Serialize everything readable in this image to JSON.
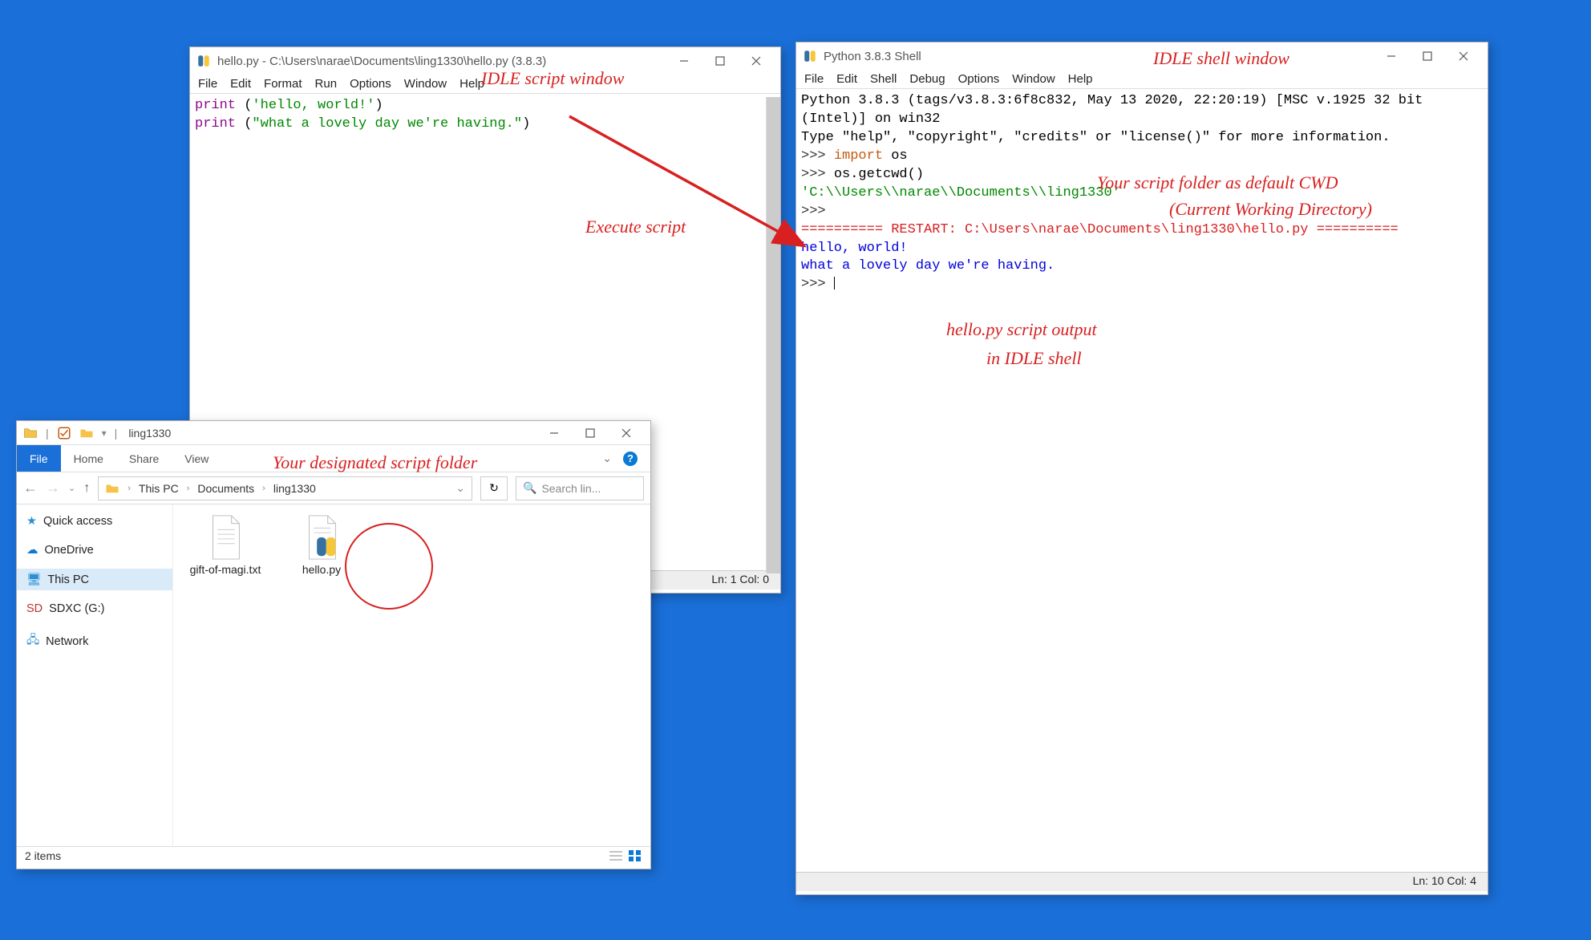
{
  "script_window": {
    "title": "hello.py - C:\\Users\\narae\\Documents\\ling1330\\hello.py (3.8.3)",
    "menu": [
      "File",
      "Edit",
      "Format",
      "Run",
      "Options",
      "Window",
      "Help"
    ],
    "line1_call": "print ",
    "line1_paren_open": "(",
    "line1_str": "'hello, world!'",
    "line1_paren_close": ")",
    "line2_call": "print ",
    "line2_paren_open": "(",
    "line2_str": "\"what a lovely day we're having.\"",
    "line2_paren_close": ")",
    "status": "Ln: 1  Col: 0"
  },
  "shell_window": {
    "title": "Python 3.8.3 Shell",
    "menu": [
      "File",
      "Edit",
      "Shell",
      "Debug",
      "Options",
      "Window",
      "Help"
    ],
    "banner1": "Python 3.8.3 (tags/v3.8.3:6f8c832, May 13 2020, 22:20:19) [MSC v.1925 32 bit (Intel)] on win32",
    "banner2": "Type \"help\", \"copyright\", \"credits\" or \"license()\" for more information.",
    "prompt": ">>> ",
    "cmd1_kw": "import",
    "cmd1_rest": " os",
    "cmd2": "os.getcwd()",
    "cwd_out": "'C:\\\\Users\\\\narae\\\\Documents\\\\ling1330'",
    "restart": "========== RESTART: C:\\Users\\narae\\Documents\\ling1330\\hello.py ==========",
    "out1": "hello, world!",
    "out2": "what a lovely day we're having.",
    "status": "Ln: 10  Col: 4"
  },
  "explorer": {
    "title": "ling1330",
    "tabs": [
      "File",
      "Home",
      "Share",
      "View"
    ],
    "breadcrumb": [
      "This PC",
      "Documents",
      "ling1330"
    ],
    "search_placeholder": "Search lin...",
    "nav_items": [
      {
        "label": "Quick access"
      },
      {
        "label": "OneDrive"
      },
      {
        "label": "This PC"
      },
      {
        "label": "SDXC (G:)"
      },
      {
        "label": "Network"
      }
    ],
    "files": [
      {
        "name": "gift-of-magi.txt"
      },
      {
        "name": "hello.py"
      }
    ],
    "status": "2 items"
  },
  "annotations": {
    "idle_script": "IDLE script window",
    "idle_shell": "IDLE shell window",
    "execute": "Execute script",
    "cwd1": "Your script folder as default CWD",
    "cwd2": "(Current Working Directory)",
    "output1": "hello.py script output",
    "output2": "in IDLE shell",
    "folder": "Your designated script folder"
  }
}
